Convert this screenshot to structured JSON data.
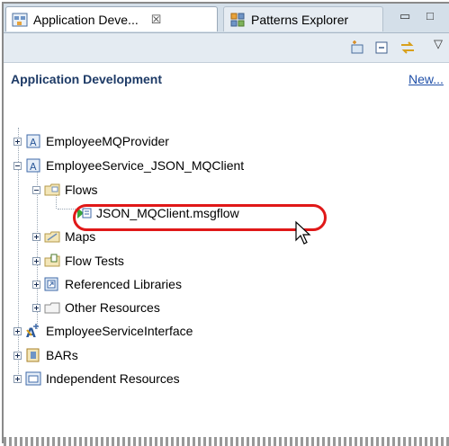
{
  "tabs": [
    {
      "label": "Application Deve...",
      "close": "☒",
      "icon": "application-development-icon"
    },
    {
      "label": "Patterns Explorer",
      "icon": "patterns-explorer-icon"
    }
  ],
  "window_controls": {
    "minimize": "▭",
    "maximize": "□"
  },
  "toolbar": {
    "icons": [
      "new-wizard-icon",
      "collapse-all-icon",
      "link-with-editor-icon",
      "view-menu-icon"
    ],
    "view_menu": "▽"
  },
  "header": {
    "title": "Application Development",
    "new_link": "New..."
  },
  "tree": {
    "employee_mq_provider": "EmployeeMQProvider",
    "employee_service": "EmployeeService_JSON_MQClient",
    "flows": "Flows",
    "msgflow": "JSON_MQClient.msgflow",
    "maps": "Maps",
    "flow_tests": "Flow Tests",
    "referenced_libraries": "Referenced Libraries",
    "other_resources": "Other Resources",
    "employee_service_interface": "EmployeeServiceInterface",
    "bars": "BARs",
    "independent_resources": "Independent Resources"
  },
  "colors": {
    "highlight": "#e01818",
    "header_title": "#1d3a66",
    "link": "#1f4fa8",
    "tabbar": "#d4dfe9"
  }
}
